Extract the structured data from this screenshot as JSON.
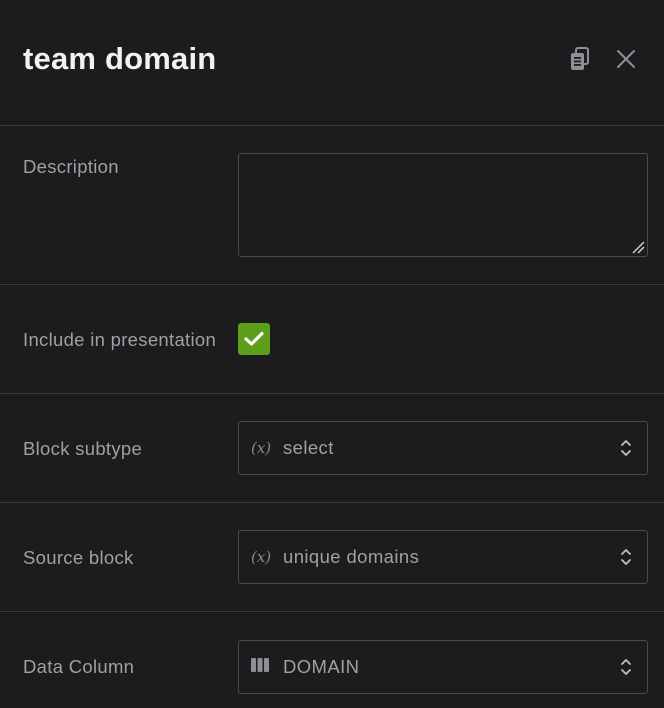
{
  "header": {
    "title": "team domain",
    "copy_icon": "clipboard-icon",
    "close_icon": "close-icon"
  },
  "fields": {
    "description": {
      "label": "Description",
      "value": ""
    },
    "include": {
      "label": "Include in presentation",
      "checked": true
    },
    "block_subtype": {
      "label": "Block subtype",
      "prefix": "(x)",
      "value": "select"
    },
    "source_block": {
      "label": "Source block",
      "prefix": "(x)",
      "value": "unique domains"
    },
    "data_column": {
      "label": "Data Column",
      "prefix_icon": "column-icon",
      "value": "DOMAIN"
    }
  },
  "colors": {
    "background": "#1c1c1e",
    "border": "#3a3a3d",
    "checkbox": "#5a9e1a",
    "title": "#f2f2f4",
    "label": "#a0a0a4"
  }
}
